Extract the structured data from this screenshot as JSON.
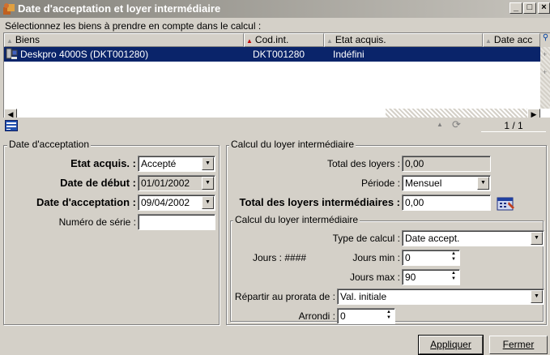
{
  "window": {
    "title": "Date d'acceptation et loyer intermédiaire",
    "minimize": "_",
    "maximize": "□",
    "close": "×"
  },
  "instruction": "Sélectionnez les biens à prendre en compte dans le calcul :",
  "grid": {
    "columns": [
      "Biens",
      "Cod.int.",
      "Etat acquis.",
      "Date acc"
    ],
    "rows": [
      {
        "bien": "Deskpro 4000S (DKT001280)",
        "cod_int": "DKT001280",
        "etat": "Indéfini"
      }
    ],
    "page": "1 / 1"
  },
  "date_group": {
    "legend": "Date d'acceptation",
    "etat_label": "Etat acquis. :",
    "etat_value": "Accepté",
    "debut_label": "Date de début :",
    "debut_value": "01/01/2002",
    "accept_label": "Date d'acceptation :",
    "accept_value": "09/04/2002",
    "serie_label": "Numéro de série :",
    "serie_value": ""
  },
  "loyer_group": {
    "legend": "Calcul du loyer intermédiaire",
    "total_loyers_label": "Total des loyers :",
    "total_loyers_value": "0,00",
    "periode_label": "Période :",
    "periode_value": "Mensuel",
    "total_inter_label": "Total des loyers intermédiaires :",
    "total_inter_value": "0,00",
    "sub": {
      "legend": "Calcul du loyer intermédiaire",
      "type_label": "Type de calcul :",
      "type_value": "Date accept.",
      "jours_label": "Jours : ####",
      "jours_min_label": "Jours min :",
      "jours_min_value": "0",
      "jours_max_label": "Jours max :",
      "jours_max_value": "90",
      "prorata_label": "Répartir au prorata de :",
      "prorata_value": "Val. initiale",
      "arrondi_label": "Arrondi :",
      "arrondi_value": "0"
    }
  },
  "buttons": {
    "apply": "Appliquer",
    "close": "Fermer"
  }
}
